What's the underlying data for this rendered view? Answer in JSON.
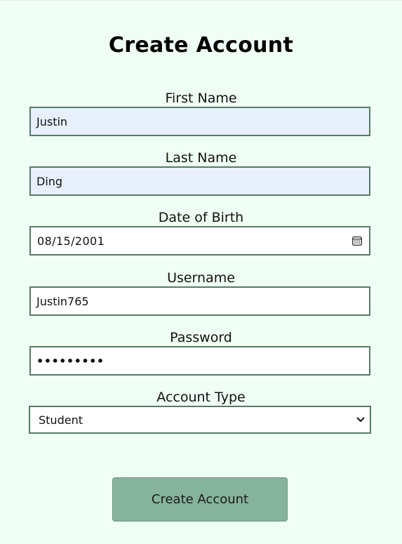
{
  "form": {
    "title": "Create Account",
    "first_name": {
      "label": "First Name",
      "value": "Justin"
    },
    "last_name": {
      "label": "Last Name",
      "value": "Ding"
    },
    "dob": {
      "label": "Date of Birth",
      "value": "08/15/2001",
      "icon": "calendar-icon"
    },
    "username": {
      "label": "Username",
      "value": "Justin765"
    },
    "password": {
      "label": "Password",
      "masked_value": "•••••••••"
    },
    "account_type": {
      "label": "Account Type",
      "selected": "Student",
      "icon": "chevron-down-icon"
    },
    "submit_label": "Create Account"
  },
  "colors": {
    "background": "#f0fff5",
    "field_border": "#567a66",
    "autofill_fill": "#e8f0fe",
    "button_fill": "#86b39b"
  }
}
